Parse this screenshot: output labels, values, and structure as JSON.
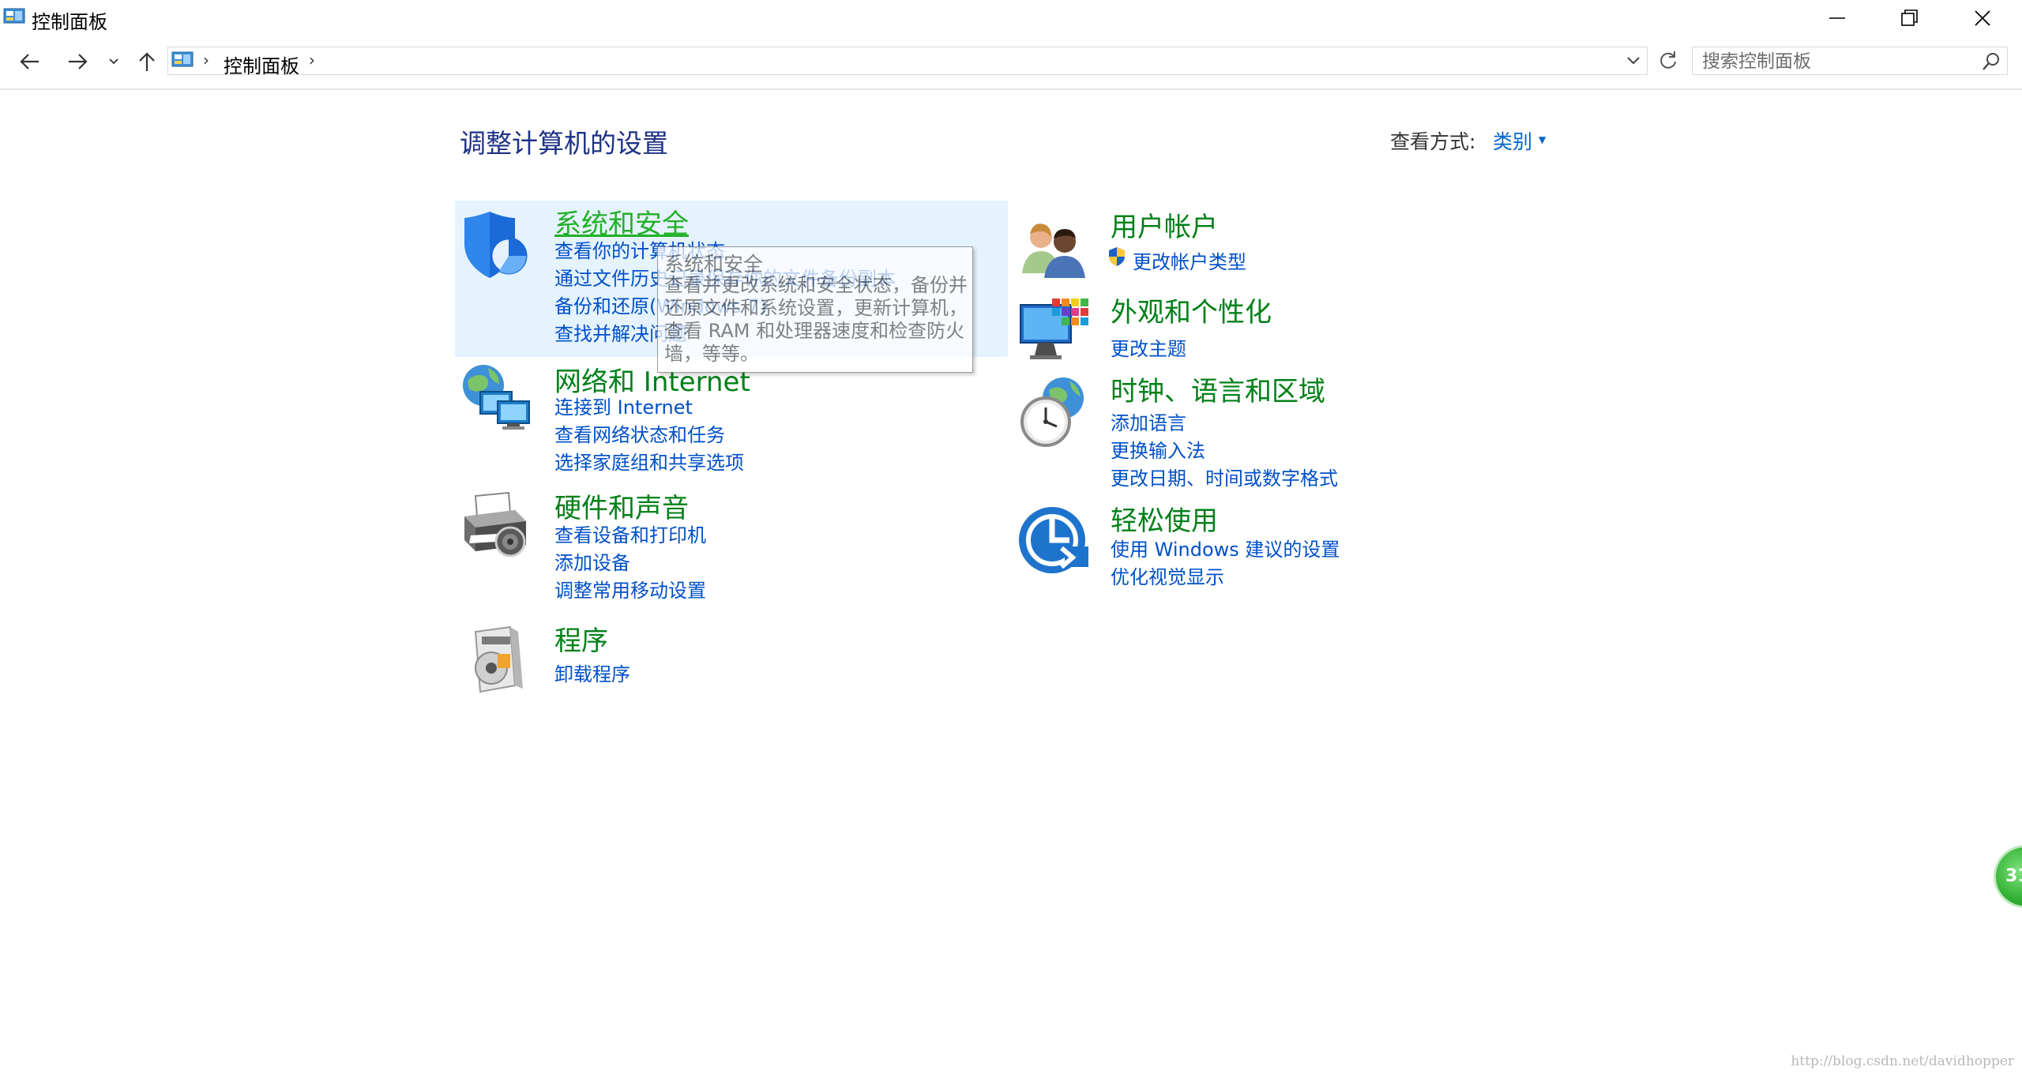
{
  "window": {
    "title": "控制面板",
    "colors": {
      "heading": "#1e3287",
      "category": "#008018",
      "link": "#0050c8",
      "hover_bg": "#e5f3ff"
    }
  },
  "address": {
    "crumbs": [
      "控制面板"
    ],
    "search_placeholder": "搜索控制面板"
  },
  "main": {
    "heading": "调整计算机的设置",
    "view_by_label": "查看方式:",
    "view_by_value": "类别"
  },
  "categories": [
    {
      "id": "system",
      "icon": "shield-icon",
      "title": "系统和安全",
      "links": [
        "查看你的计算机状态",
        "通过文件历史记录保存你的文件备份副本",
        "备份和还原(Windows 7)",
        "查找并解决问题"
      ]
    },
    {
      "id": "network",
      "icon": "network-globe-icon",
      "title": "网络和 Internet",
      "links": [
        "连接到 Internet",
        "查看网络状态和任务",
        "选择家庭组和共享选项"
      ]
    },
    {
      "id": "hardware",
      "icon": "printer-icon",
      "title": "硬件和声音",
      "links": [
        "查看设备和打印机",
        "添加设备",
        "调整常用移动设置"
      ]
    },
    {
      "id": "programs",
      "icon": "programs-disc-icon",
      "title": "程序",
      "links": [
        "卸载程序"
      ]
    },
    {
      "id": "users",
      "icon": "users-icon",
      "title": "用户帐户",
      "links": [
        "更改帐户类型"
      ]
    },
    {
      "id": "appearance",
      "icon": "monitor-palette-icon",
      "title": "外观和个性化",
      "links": [
        "更改主题"
      ]
    },
    {
      "id": "clock",
      "icon": "clock-globe-icon",
      "title": "时钟、语言和区域",
      "links": [
        "添加语言",
        "更换输入法",
        "更改日期、时间或数字格式"
      ]
    },
    {
      "id": "ease",
      "icon": "ease-of-access-icon",
      "title": "轻松使用",
      "links": [
        "使用 Windows 建议的设置",
        "优化视觉显示"
      ]
    }
  ],
  "tooltip": {
    "title": "系统和安全",
    "body": "查看并更改系统和安全状态，备份并还原文件和系统设置，更新计算机，查看 RAM 和处理器速度和检查防火墙，等等。"
  },
  "badge": {
    "text": "31"
  },
  "watermark": "http://blog.csdn.net/davidhopper"
}
